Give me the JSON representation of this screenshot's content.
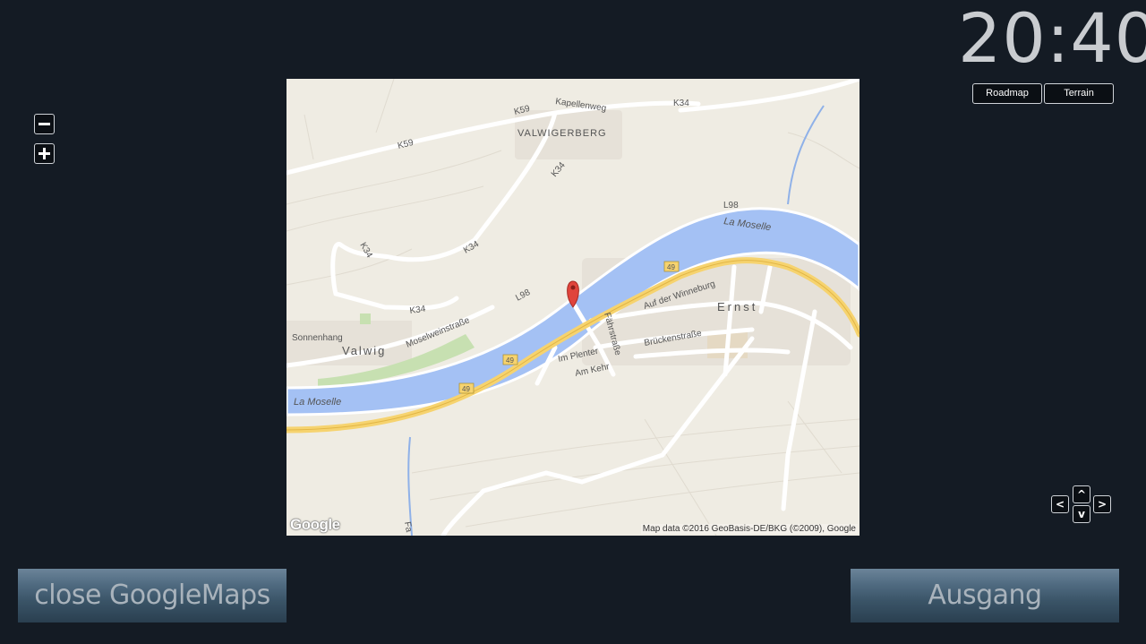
{
  "clock": {
    "time": "20:40"
  },
  "map_type": {
    "roadmap": "Roadmap",
    "terrain": "Terrain"
  },
  "zoom": {
    "out_icon": "minus-icon",
    "in_icon": "plus-icon"
  },
  "map": {
    "labels": {
      "valwigerberg": "VALWIGERBERG",
      "k59_a": "K59",
      "k59_b": "K59",
      "kapellenweg": "Kapellenweg",
      "k34_a": "K34",
      "k34_b": "K34",
      "k34_c": "K34",
      "k34_d": "K34",
      "k34_e": "K34",
      "l98_a": "L98",
      "l98_b": "L98",
      "moselle_top": "La Moselle",
      "moselle_bottom": "La Moselle",
      "b49_a": "49",
      "b49_b": "49",
      "b49_c": "49",
      "auf_der_winneburg": "Auf der Winneburg",
      "ernst": "Ernst",
      "faehrstrasse": "Fährstraße",
      "brueckenstrasse": "Brückenstraße",
      "im_plenter": "Im Plenter",
      "am_kehr": "Am Kehr",
      "moselweinstrasse": "Moselweinstraße",
      "sonnenhang": "Sonnenhang",
      "valwig": "Valwig",
      "fa": "Fa"
    },
    "logo": "Google",
    "attribution": "Map data ©2016 GeoBasis-DE/BKG (©2009), Google",
    "marker_icon": "map-pin-icon"
  },
  "pan": {
    "up": "^",
    "down": "v",
    "left": "<",
    "right": ">"
  },
  "buttons": {
    "close_maps": "close  GoogleMaps",
    "exit": "Ausgang"
  },
  "colors": {
    "background": "#141b24",
    "river": "#a4c1f4",
    "highway": "#f6d36f",
    "map_bg": "#efece3"
  }
}
